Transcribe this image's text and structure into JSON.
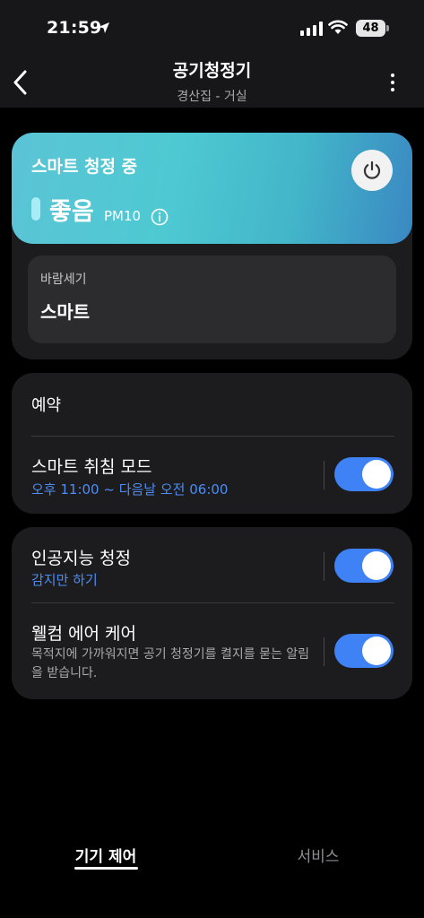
{
  "status_bar": {
    "time": "21:59",
    "battery": "48"
  },
  "header": {
    "title": "공기청정기",
    "subtitle": "경산집 - 거실"
  },
  "hero": {
    "status": "스마트 청정 중",
    "air_quality": "좋음",
    "pm_label": "PM10",
    "gradient_colors": [
      "#5bc4d6",
      "#4ec9d2",
      "#3a88c2"
    ]
  },
  "fan": {
    "label": "바람세기",
    "value": "스마트"
  },
  "schedule": {
    "title": "예약",
    "sleep_mode": {
      "title": "스마트 취침 모드",
      "time_range": "오후 11:00 ~ 다음날 오전 06:00",
      "enabled": true
    }
  },
  "ai": {
    "ai_purify": {
      "title": "인공지능 청정",
      "subtitle": "감지만 하기",
      "enabled": true
    },
    "welcome_air": {
      "title": "웰컴 에어 케어",
      "description": "목적지에 가까워지면 공기 청정기를 켤지를 묻는 알림을 받습니다.",
      "enabled": true
    }
  },
  "tabs": {
    "device_control": "기기 제어",
    "services": "서비스"
  },
  "colors": {
    "accent": "#3e82f5",
    "link_text": "#4b8cf5",
    "card_bg": "#1c1c1e"
  }
}
